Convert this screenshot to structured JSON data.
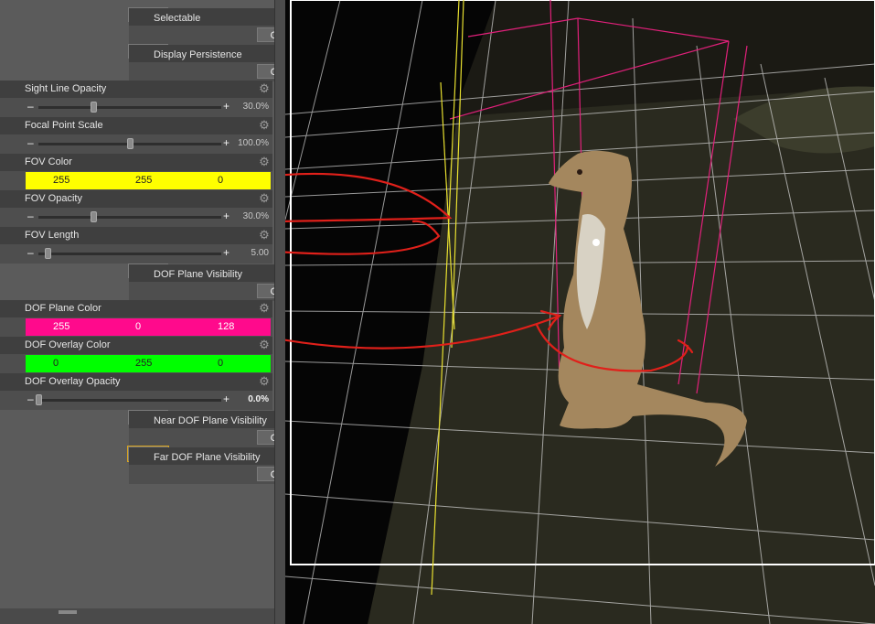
{
  "properties": [
    {
      "label": "Selectable",
      "type": "toggle",
      "value": "On"
    },
    {
      "label": "Display Persistence",
      "type": "toggle",
      "value": "Off"
    },
    {
      "label": "Sight Line Opacity",
      "type": "slider",
      "value_text": "30.0%",
      "fraction": 0.3
    },
    {
      "label": "Focal Point Scale",
      "type": "slider",
      "value_text": "100.0%",
      "fraction": 0.5
    },
    {
      "label": "FOV Color",
      "type": "color",
      "color": "#ffff00",
      "r": "255",
      "g": "255",
      "b": "0"
    },
    {
      "label": "FOV Opacity",
      "type": "slider",
      "value_text": "30.0%",
      "fraction": 0.3
    },
    {
      "label": "FOV Length",
      "type": "slider",
      "value_text": "5.00",
      "fraction": 0.05
    },
    {
      "label": "DOF Plane Visibility",
      "type": "toggle",
      "value": "On"
    },
    {
      "label": "DOF Plane Color",
      "type": "color",
      "color": "#ff0a8c",
      "r": "255",
      "g": "0",
      "b": "128"
    },
    {
      "label": "DOF Overlay Color",
      "type": "color",
      "color": "#00ff00",
      "r": "0",
      "g": "255",
      "b": "0"
    },
    {
      "label": "DOF Overlay Opacity",
      "type": "slider",
      "value_text": "0.0%",
      "fraction": 0.0
    },
    {
      "label": "Near DOF Plane Visibility",
      "type": "toggle",
      "value": "Off"
    },
    {
      "label": "Far DOF Plane Visibility",
      "type": "toggle",
      "value": "Off",
      "selected": true
    }
  ],
  "icons": {
    "gear": "gear-icon",
    "minus": "minus",
    "plus": "plus"
  },
  "colors": {
    "panel": "#5b5b5b",
    "header": "#3f3f3f",
    "annotation": "#e0201a",
    "dof_plane": "#e0207a",
    "fov": "#e8e030",
    "grid": "#e6e6e6"
  }
}
